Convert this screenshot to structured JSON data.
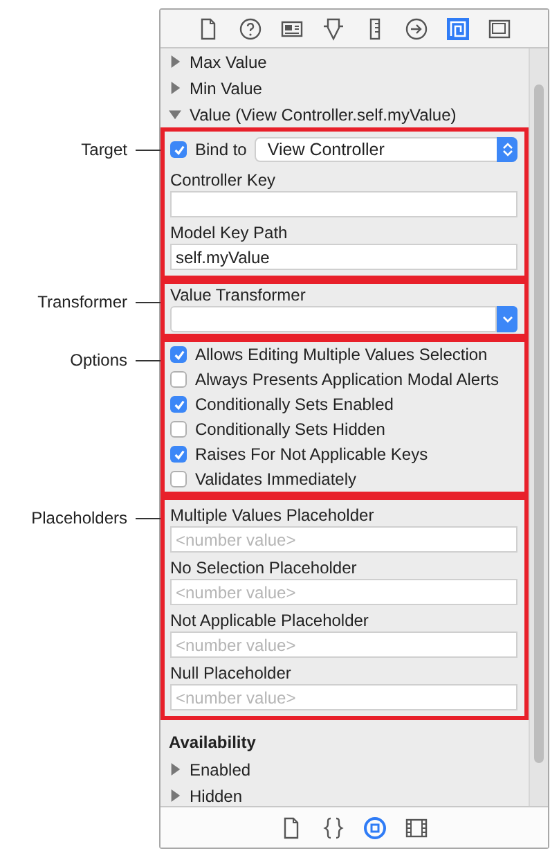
{
  "toolbar": [
    {
      "kind": "file",
      "selected": false
    },
    {
      "kind": "help",
      "selected": false
    },
    {
      "kind": "identity",
      "selected": false
    },
    {
      "kind": "attributes",
      "selected": false
    },
    {
      "kind": "size",
      "selected": false
    },
    {
      "kind": "connections",
      "selected": false
    },
    {
      "kind": "bindings",
      "selected": true
    },
    {
      "kind": "effects",
      "selected": false
    }
  ],
  "disclosures": [
    {
      "label": "Max Value",
      "expanded": false
    },
    {
      "label": "Min Value",
      "expanded": false
    },
    {
      "label": "Value (View Controller.self.myValue)",
      "expanded": true
    }
  ],
  "sections": [
    {
      "callout": "Target",
      "kind": "target",
      "bind": {
        "label": "Bind to",
        "checked": true,
        "value": "View Controller"
      },
      "fields": [
        {
          "label": "Controller Key"
        },
        {
          "label": "Model Key Path",
          "value": "self.myValue"
        }
      ]
    },
    {
      "callout": "Transformer",
      "kind": "transformer",
      "label": "Value Transformer"
    },
    {
      "callout": "Options",
      "kind": "options",
      "options": [
        {
          "label": "Allows Editing Multiple Values Selection",
          "checked": true
        },
        {
          "label": "Always Presents Application Modal Alerts",
          "checked": false
        },
        {
          "label": "Conditionally Sets Enabled",
          "checked": true
        },
        {
          "label": "Conditionally Sets Hidden",
          "checked": false
        },
        {
          "label": "Raises For Not Applicable Keys",
          "checked": true
        },
        {
          "label": "Validates Immediately",
          "checked": false
        }
      ]
    },
    {
      "callout": "Placeholders",
      "kind": "placeholders",
      "fields": [
        {
          "label": "Multiple Values Placeholder",
          "placeholder": "<number value>"
        },
        {
          "label": "No Selection Placeholder",
          "placeholder": "<number value>"
        },
        {
          "label": "Not Applicable Placeholder",
          "placeholder": "<number value>"
        },
        {
          "label": "Null Placeholder",
          "placeholder": "<number value>"
        }
      ]
    }
  ],
  "availability": {
    "title": "Availability",
    "items": [
      {
        "label": "Enabled",
        "expanded": false
      },
      {
        "label": "Hidden",
        "expanded": false
      }
    ]
  },
  "footer": [
    {
      "kind": "file",
      "selected": false
    },
    {
      "kind": "braces",
      "selected": false
    },
    {
      "kind": "object",
      "selected": true
    },
    {
      "kind": "media",
      "selected": false
    }
  ]
}
